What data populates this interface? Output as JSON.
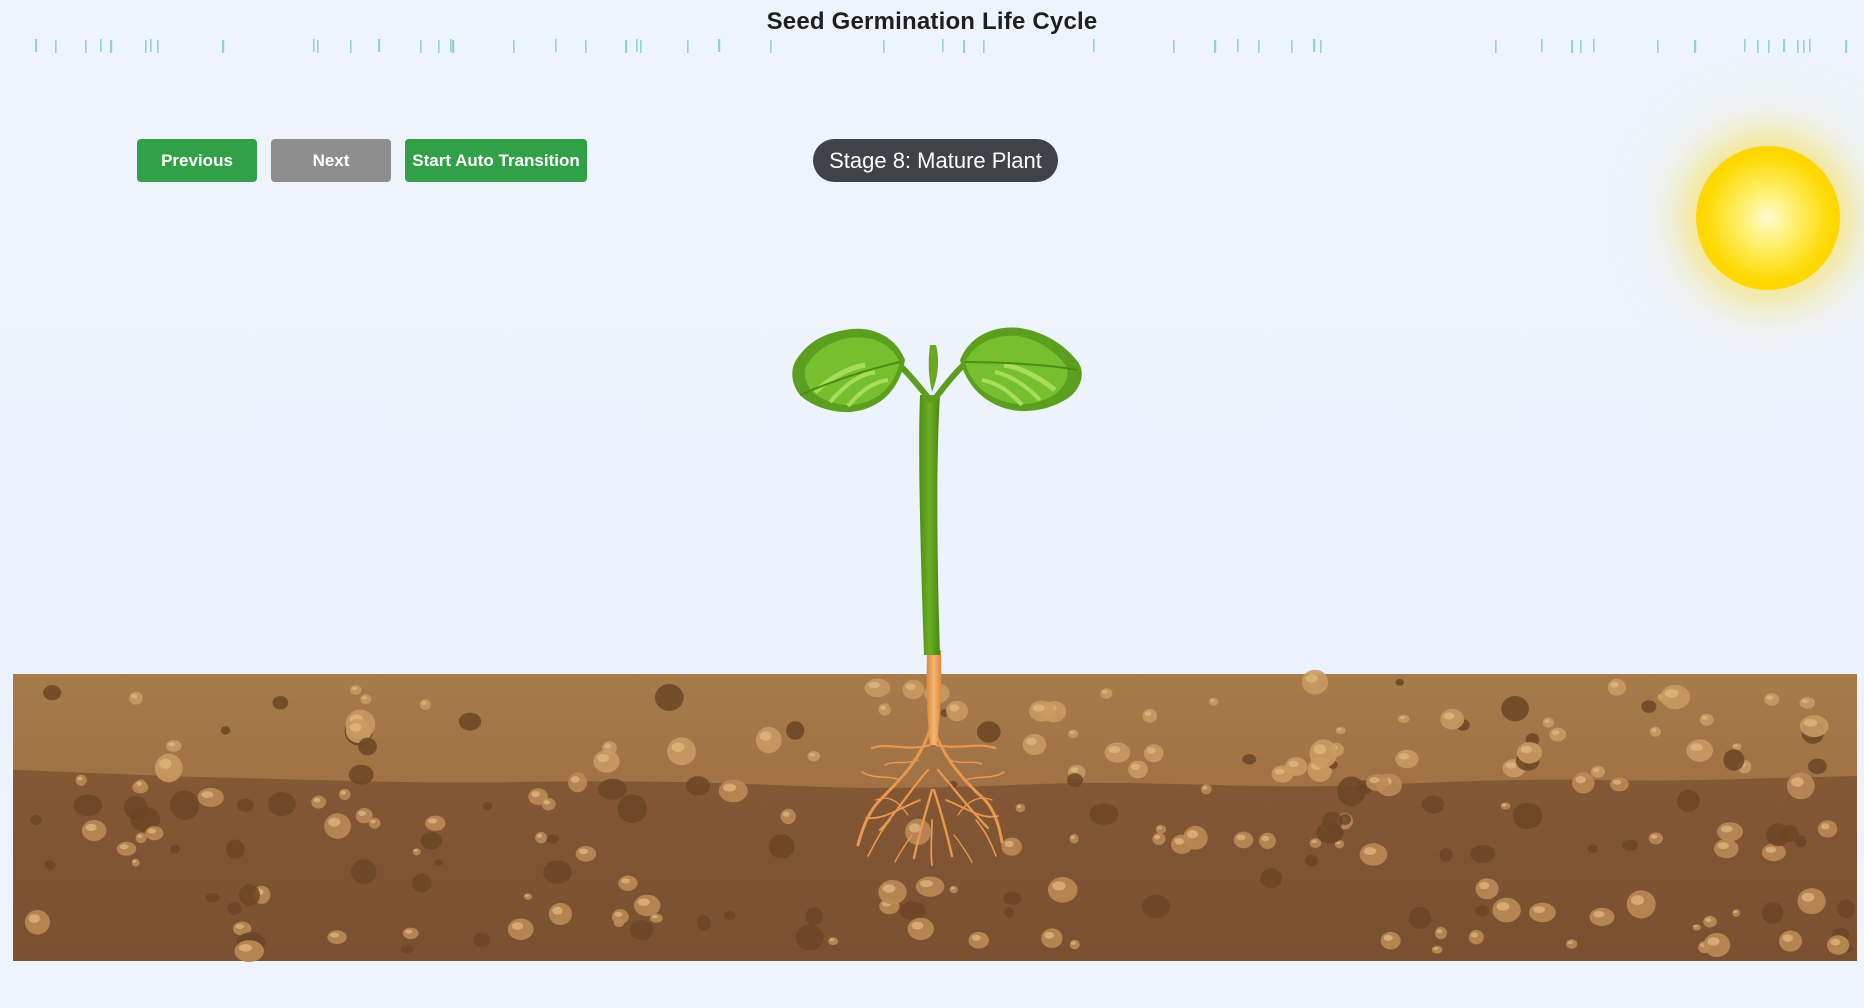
{
  "header": {
    "title": "Seed Germination Life Cycle"
  },
  "controls": {
    "previous_label": "Previous",
    "next_label": "Next",
    "auto_label": "Start Auto Transition"
  },
  "stage": {
    "label": "Stage 8: Mature Plant"
  },
  "colors": {
    "button_green": "#32a046",
    "button_gray": "#8e8e8e",
    "badge_bg": "#3f4347",
    "soil_top": "#a97d4d",
    "soil_bottom": "#7d5232",
    "leaf_green": "#5a9a1e",
    "root_orange": "#e89a4f",
    "sun_yellow": "#ffd900",
    "rain_teal": "#7ec8d0"
  },
  "icons": {
    "sun": "sun-icon",
    "plant": "plant-icon",
    "rain": "raindrops-icon"
  }
}
